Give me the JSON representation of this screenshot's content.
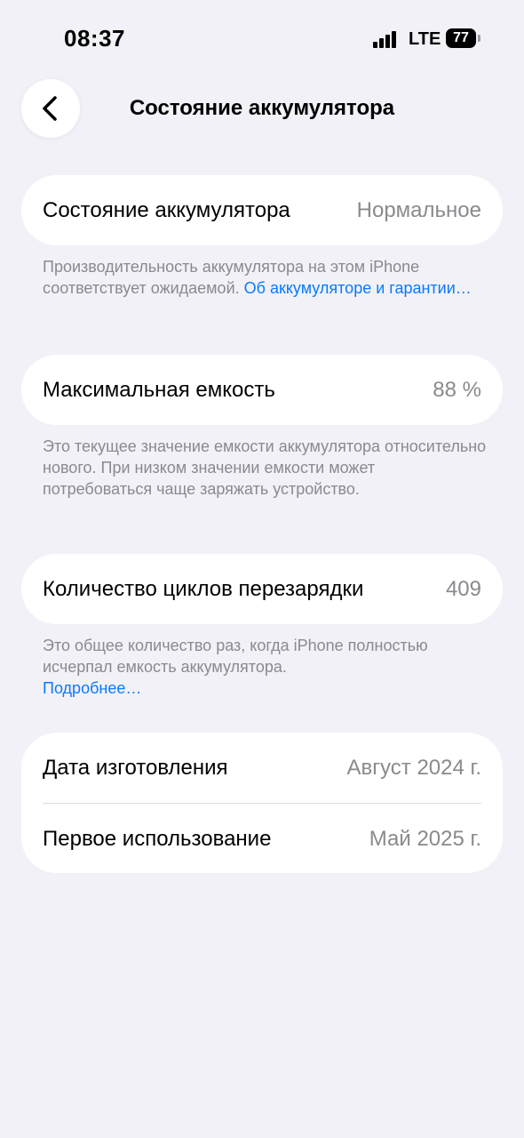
{
  "status_bar": {
    "time": "08:37",
    "network": "LTE",
    "battery_percent": "77"
  },
  "nav": {
    "back_icon": "chevron-left-icon",
    "title": "Состояние аккумулятора"
  },
  "battery_health": {
    "label": "Состояние аккумулятора",
    "value": "Нормальное",
    "footnote_text": "Производительность аккумулятора на этом iPhone соответствует ожидаемой. ",
    "footnote_link": "Об аккумуляторе и гарантии…"
  },
  "max_capacity": {
    "label": "Максимальная емкость",
    "value": "88 %",
    "footnote_text": "Это текущее значение емкости аккумулятора относительно нового. При низком значении емкости может потребоваться чаще заряжать устройство."
  },
  "cycle_count": {
    "label": "Количество циклов перезарядки",
    "value": "409",
    "footnote_text": "Это общее количество раз, когда iPhone полностью исчерпал емкость аккумулятора.",
    "footnote_link": "Подробнее…"
  },
  "dates": {
    "manufacture_label": "Дата изготовления",
    "manufacture_value": "Август 2024 г.",
    "first_use_label": "Первое использование",
    "first_use_value": "Май 2025 г."
  },
  "colors": {
    "background": "#f2f1f7",
    "card": "#ffffff",
    "secondary_text": "#8a8a8e",
    "link": "#0a7aff"
  }
}
